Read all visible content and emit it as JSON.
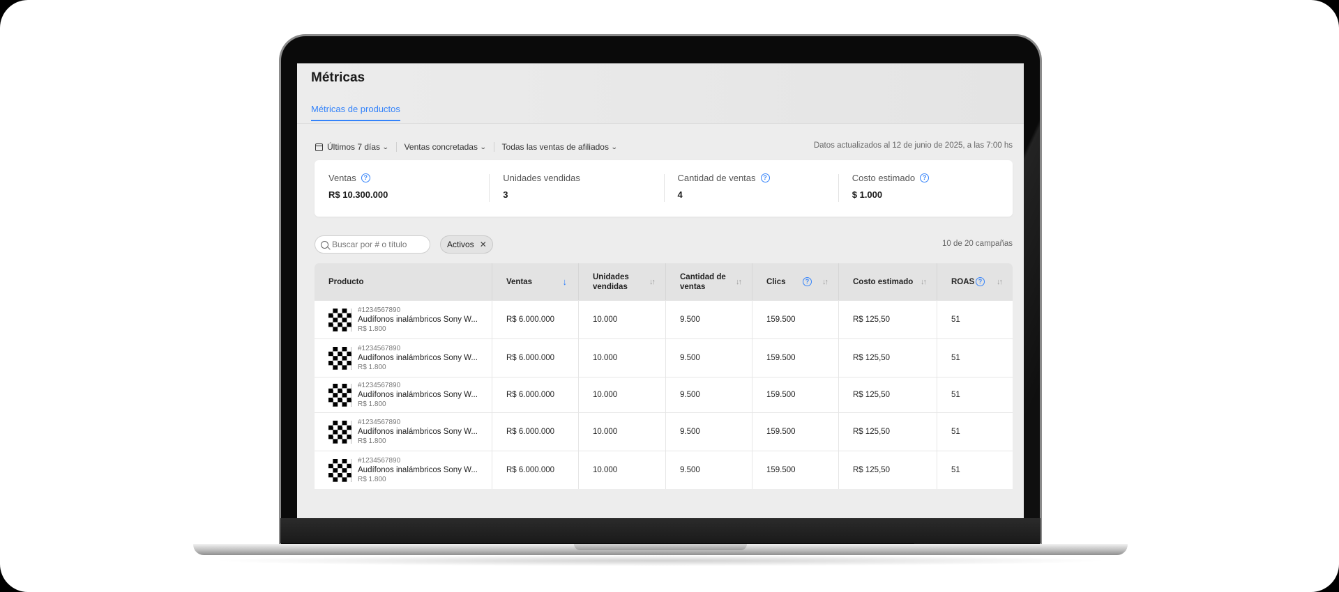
{
  "page": {
    "title": "Métricas",
    "tab": "Métricas de productos"
  },
  "filters": {
    "period": "Últimos 7 días",
    "sales_type": "Ventas concretadas",
    "affiliates": "Todas las ventas de afiliados",
    "updated": "Datos actualizados al 12 de junio de 2025, a las 7:00 hs"
  },
  "kpis": [
    {
      "label": "Ventas",
      "value": "R$ 10.300.000",
      "help": true
    },
    {
      "label": "Unidades vendidas",
      "value": "3",
      "help": false
    },
    {
      "label": "Cantidad de ventas",
      "value": "4",
      "help": true
    },
    {
      "label": "Costo estimado",
      "value": "$ 1.000",
      "help": true
    }
  ],
  "search": {
    "placeholder": "Buscar por # o título"
  },
  "chip": {
    "label": "Activos"
  },
  "count": "10 de 20 campañas",
  "table": {
    "headers": {
      "producto": "Producto",
      "ventas": "Ventas",
      "unidades": "Unidades vendidas",
      "cantidad": "Cantidad de ventas",
      "clics": "Clics",
      "costo": "Costo estimado",
      "roas": "ROAS"
    },
    "rows": [
      {
        "id": "#1234567890",
        "name": "Audífonos inalámbricos Sony W...",
        "price": "R$ 1.800",
        "ventas": "R$ 6.000.000",
        "unidades": "10.000",
        "cantidad": "9.500",
        "clics": "159.500",
        "costo": "R$ 125,50",
        "roas": "51"
      },
      {
        "id": "#1234567890",
        "name": "Audífonos inalámbricos Sony W...",
        "price": "R$ 1.800",
        "ventas": "R$ 6.000.000",
        "unidades": "10.000",
        "cantidad": "9.500",
        "clics": "159.500",
        "costo": "R$ 125,50",
        "roas": "51"
      },
      {
        "id": "#1234567890",
        "name": "Audífonos inalámbricos Sony W...",
        "price": "R$ 1.800",
        "ventas": "R$ 6.000.000",
        "unidades": "10.000",
        "cantidad": "9.500",
        "clics": "159.500",
        "costo": "R$ 125,50",
        "roas": "51"
      },
      {
        "id": "#1234567890",
        "name": "Audífonos inalámbricos Sony W...",
        "price": "R$ 1.800",
        "ventas": "R$ 6.000.000",
        "unidades": "10.000",
        "cantidad": "9.500",
        "clics": "159.500",
        "costo": "R$ 125,50",
        "roas": "51"
      },
      {
        "id": "#1234567890",
        "name": "Audífonos inalámbricos Sony W...",
        "price": "R$ 1.800",
        "ventas": "R$ 6.000.000",
        "unidades": "10.000",
        "cantidad": "9.500",
        "clics": "159.500",
        "costo": "R$ 125,50",
        "roas": "51"
      }
    ]
  },
  "colors": {
    "accent": "#3483fa",
    "background": "#ededed",
    "header_row": "#e3e3e3"
  },
  "icons": {
    "calendar": "calendar-icon",
    "chevron": "chevron-down-icon",
    "help": "help-icon",
    "search": "search-icon",
    "close": "close-icon",
    "sort": "sort-icon",
    "sort_active": "arrow-down-icon",
    "thumbnail": "product-thumbnail"
  }
}
